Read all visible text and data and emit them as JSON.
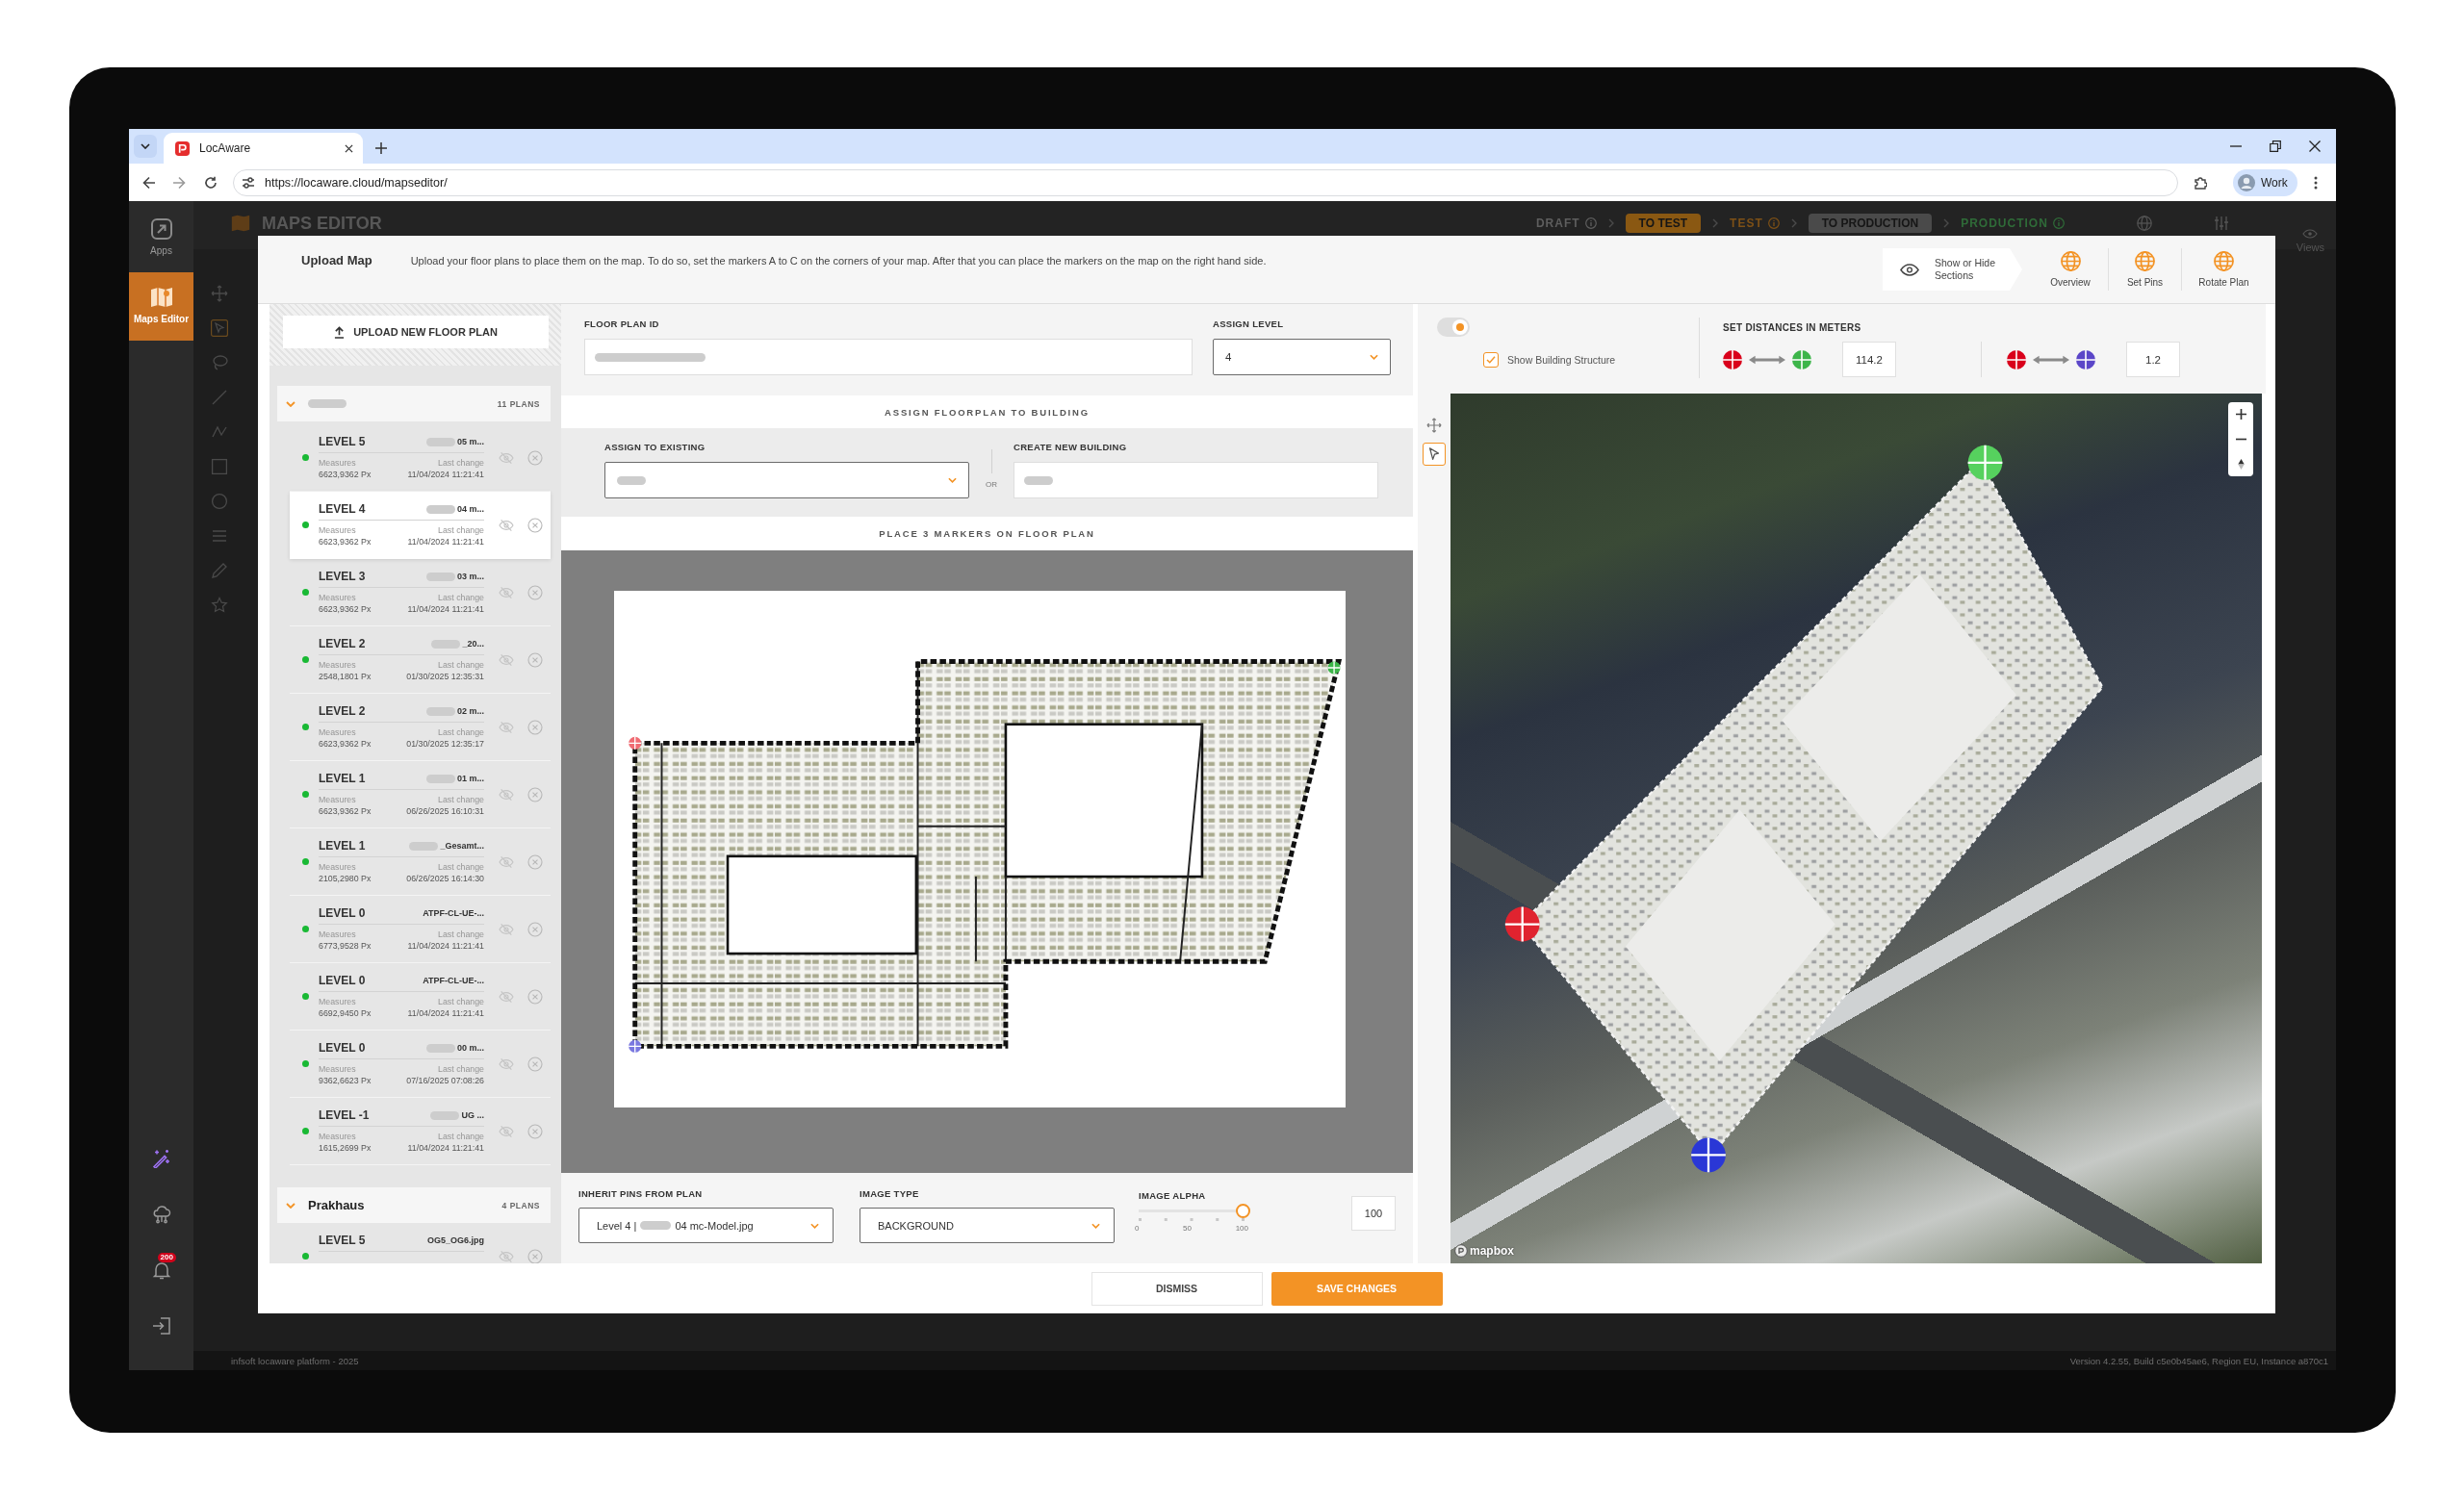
{
  "browser": {
    "tab_title": "LocAware",
    "url": "https://locaware.cloud/mapseditor/",
    "profile": "Work"
  },
  "app_sidebar": {
    "items": [
      {
        "label": "Apps",
        "kind": "apps",
        "selected": false
      },
      {
        "label": "Maps Editor",
        "kind": "maps",
        "selected": true
      }
    ],
    "notification_badge": "200"
  },
  "background": {
    "title": "MAPS EDITOR",
    "stages": [
      {
        "label": "DRAFT",
        "kind": "step",
        "color": "#5e5e5e"
      },
      {
        "label": "TO TEST",
        "kind": "action",
        "color": "#8a5812"
      },
      {
        "label": "TEST",
        "kind": "step",
        "color": "#7d5016"
      },
      {
        "label": "TO PRODUCTION",
        "kind": "action",
        "color": "#4a4a4a"
      },
      {
        "label": "PRODUCTION",
        "kind": "step",
        "color": "#2f6b38"
      }
    ],
    "views_label": "Views"
  },
  "dialog": {
    "title": "Upload Map",
    "description": "Upload your floor plans to place them on the map. To do so, set the markers A to C on the corners of your map. After that you can place the markers on the map on the right hand side.",
    "toolbar": [
      {
        "label": "Show or Hide Sections",
        "kind": "sections"
      },
      {
        "label": "Overview",
        "kind": "tool"
      },
      {
        "label": "Set Pins",
        "kind": "tool"
      },
      {
        "label": "Rotate Plan",
        "kind": "tool"
      }
    ],
    "upload_button": "UPLOAD NEW FLOOR PLAN",
    "buildings": [
      {
        "name_blurred": true,
        "count": "11 PLANS",
        "expanded": true,
        "plans": [
          {
            "level": "LEVEL 5",
            "file": "05 m...",
            "file_blurred": true,
            "active": true,
            "selected": false,
            "measures_label": "Measures",
            "measures": "6623,9362 Px",
            "change_label": "Last change",
            "changed": "11/04/2024 11:21:41"
          },
          {
            "level": "LEVEL 4",
            "file": "04 m...",
            "file_blurred": true,
            "active": true,
            "selected": true,
            "measures_label": "Measures",
            "measures": "6623,9362 Px",
            "change_label": "Last change",
            "changed": "11/04/2024 11:21:41"
          },
          {
            "level": "LEVEL 3",
            "file": "03 m...",
            "file_blurred": true,
            "active": true,
            "selected": false,
            "measures_label": "Measures",
            "measures": "6623,9362 Px",
            "change_label": "Last change",
            "changed": "11/04/2024 11:21:41"
          },
          {
            "level": "LEVEL 2",
            "file": "_20...",
            "file_blurred": true,
            "active": true,
            "selected": false,
            "measures_label": "Measures",
            "measures": "2548,1801 Px",
            "change_label": "Last change",
            "changed": "01/30/2025 12:35:31"
          },
          {
            "level": "LEVEL 2",
            "file": "02 m...",
            "file_blurred": true,
            "active": true,
            "selected": false,
            "measures_label": "Measures",
            "measures": "6623,9362 Px",
            "change_label": "Last change",
            "changed": "01/30/2025 12:35:17"
          },
          {
            "level": "LEVEL 1",
            "file": "01 m...",
            "file_blurred": true,
            "active": true,
            "selected": false,
            "measures_label": "Measures",
            "measures": "6623,9362 Px",
            "change_label": "Last change",
            "changed": "06/26/2025 16:10:31"
          },
          {
            "level": "LEVEL 1",
            "file": "_Gesamt...",
            "file_blurred": true,
            "active": true,
            "selected": false,
            "measures_label": "Measures",
            "measures": "2105,2980 Px",
            "change_label": "Last change",
            "changed": "06/26/2025 16:14:30"
          },
          {
            "level": "LEVEL 0",
            "file": "ATPF-CL-UE-...",
            "file_blurred": false,
            "active": true,
            "selected": false,
            "measures_label": "Measures",
            "measures": "6773,9528 Px",
            "change_label": "Last change",
            "changed": "11/04/2024 11:21:41"
          },
          {
            "level": "LEVEL 0",
            "file": "ATPF-CL-UE-...",
            "file_blurred": false,
            "active": true,
            "selected": false,
            "measures_label": "Measures",
            "measures": "6692,9450 Px",
            "change_label": "Last change",
            "changed": "11/04/2024 11:21:41"
          },
          {
            "level": "LEVEL 0",
            "file": "00 m...",
            "file_blurred": true,
            "active": true,
            "selected": false,
            "measures_label": "Measures",
            "measures": "9362,6623 Px",
            "change_label": "Last change",
            "changed": "07/16/2025 07:08:26"
          },
          {
            "level": "LEVEL -1",
            "file": "UG ...",
            "file_blurred": true,
            "active": true,
            "selected": false,
            "measures_label": "Measures",
            "measures": "1615,2699 Px",
            "change_label": "Last change",
            "changed": "11/04/2024 11:21:41"
          }
        ]
      },
      {
        "name": "Prakhaus",
        "name_blurred": false,
        "count": "4 PLANS",
        "expanded": true,
        "plans": [
          {
            "level": "LEVEL 5",
            "file": "OG5_OG6.jpg",
            "file_blurred": false,
            "active": true,
            "selected": false
          }
        ]
      }
    ],
    "floor_plan_id": {
      "label": "FLOOR PLAN ID",
      "value_blurred": true
    },
    "assign_level": {
      "label": "ASSIGN LEVEL",
      "value": "4"
    },
    "assign_title": "ASSIGN FLOORPLAN TO BUILDING",
    "assign_existing": {
      "label": "ASSIGN TO EXISTING",
      "value_blurred": true
    },
    "or_label": "OR",
    "create_building": {
      "label": "CREATE NEW BUILDING",
      "value_blurred": true
    },
    "markers_title": "PLACE 3 MARKERS ON FLOOR PLAN",
    "plan_markers": [
      {
        "color": "#f06b72"
      },
      {
        "color": "#3db54a"
      },
      {
        "color": "#7a78e0"
      }
    ],
    "inherit_pins": {
      "label": "INHERIT PINS FROM PLAN",
      "value_start": "Level 4 |",
      "value_blurred": true,
      "value_end": "04 mc-Model.jpg"
    },
    "image_type": {
      "label": "IMAGE TYPE",
      "value": "BACKGROUND"
    },
    "image_alpha": {
      "label": "IMAGE ALPHA",
      "level": 1,
      "ticks": [
        "0",
        "50",
        "100"
      ],
      "value": "100"
    },
    "plan_toggle": {
      "on": true
    },
    "building_structure": {
      "label": "Show Building Structure",
      "checked": true
    },
    "distances": {
      "title": "SET DISTANCES IN METERS",
      "pairs": [
        {
          "from": {
            "color": "#d9001b"
          },
          "to": {
            "color": "#3db54a"
          },
          "value": "114.2"
        },
        {
          "from": {
            "color": "#d9001b"
          },
          "to": {
            "color": "#5b46c8"
          },
          "value": "1.2"
        }
      ]
    },
    "map_tools": [
      {
        "kind": "move",
        "selected": false
      },
      {
        "kind": "pointer",
        "selected": true
      }
    ],
    "map_markers": [
      {
        "color": "#56d15e"
      },
      {
        "color": "#e0232f"
      },
      {
        "color": "#2a37d6"
      }
    ],
    "map_attribution": "mapbox",
    "buttons": [
      {
        "label": "DISMISS",
        "kind": "secondary"
      },
      {
        "label": "SAVE CHANGES",
        "kind": "primary"
      }
    ]
  },
  "footer": {
    "left": "infsoft locaware platform - 2025",
    "right": "Version 4.2.55, Build c5e0b45ae6, Region EU, Instance a870c1"
  }
}
